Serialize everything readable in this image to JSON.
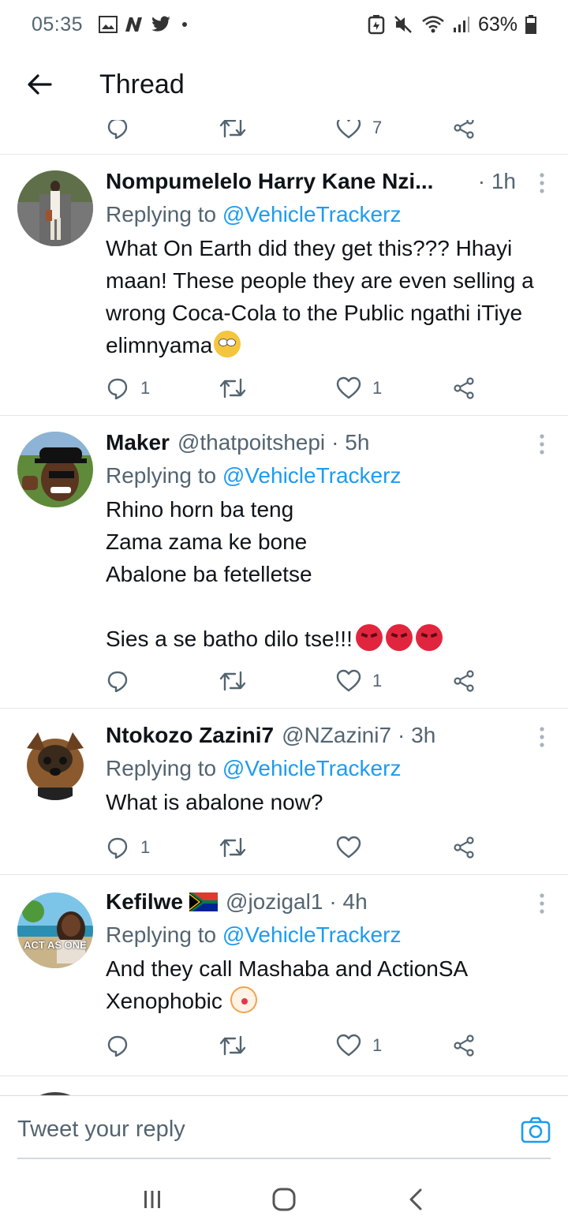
{
  "status_bar": {
    "time": "05:35",
    "battery": "63%",
    "notification_icons": [
      "gallery-icon",
      "n-icon",
      "twitter-icon"
    ]
  },
  "header": {
    "title": "Thread",
    "back_icon": "arrow-left-icon"
  },
  "partial_tweet": {
    "like_count": "7"
  },
  "tweets": [
    {
      "name": "Nompumelelo Harry Kane Nzi...",
      "handle": "",
      "time": "· 1h",
      "replying_prefix": "Replying to",
      "mention": "@VehicleTrackerz",
      "text": "What On Earth did they get this??? Hhayi maan!  These people they are even selling a wrong Coca-Cola to the Public ngathi iTiye elimnyama",
      "reply_count": "1",
      "retweet_count": "",
      "like_count": "1",
      "emojis": [
        "face-with-rolling-eyes"
      ]
    },
    {
      "name": "Maker",
      "handle": "@thatpoitshepi",
      "time": "· 5h",
      "replying_prefix": "Replying to",
      "mention": "@VehicleTrackerz",
      "text": "Rhino horn ba teng\nZama zama ke bone\nAbalone ba fetelletse\n\nSies a se batho dilo tse!!!",
      "reply_count": "",
      "retweet_count": "",
      "like_count": "1",
      "emojis": [
        "pouting-face",
        "pouting-face",
        "pouting-face"
      ]
    },
    {
      "name": "Ntokozo Zazini7",
      "handle": "@NZazini7",
      "time": "· 3h",
      "replying_prefix": "Replying to",
      "mention": "@VehicleTrackerz",
      "text": "What is abalone now?",
      "reply_count": "1",
      "retweet_count": "",
      "like_count": "",
      "emojis": []
    },
    {
      "name": "Kefilwe",
      "handle": "@jozigal1",
      "time": "· 4h",
      "replying_prefix": "Replying to",
      "mention": "@VehicleTrackerz",
      "text": "And they call Mashaba and ActionSA Xenophobic",
      "reply_count": "",
      "retweet_count": "",
      "like_count": "1",
      "emojis": [
        "clown-face"
      ],
      "avatar_text": "ACT AS ONE"
    }
  ],
  "reply_bar": {
    "placeholder": "Tweet your reply",
    "camera_icon": "camera-icon"
  },
  "navbar": {
    "icons": [
      "recent-apps-icon",
      "home-icon",
      "back-icon"
    ]
  },
  "colors": {
    "accent": "#1d9bf0",
    "secondary_text": "#536471",
    "primary_text": "#0f1419"
  }
}
